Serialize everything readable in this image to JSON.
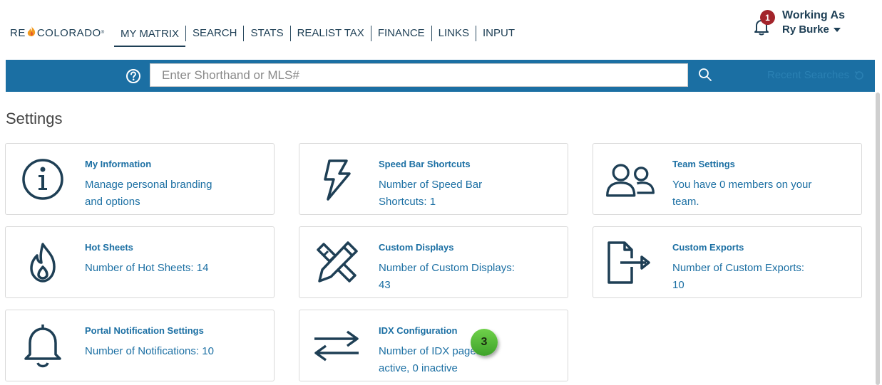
{
  "logo": {
    "text_left": "RE",
    "text_right": "COLORADO",
    "mark": "®"
  },
  "nav": {
    "items": [
      {
        "label": "MY MATRIX"
      },
      {
        "label": "SEARCH"
      },
      {
        "label": "STATS"
      },
      {
        "label": "REALIST TAX"
      },
      {
        "label": "FINANCE"
      },
      {
        "label": "LINKS"
      },
      {
        "label": "INPUT"
      }
    ]
  },
  "notifications": {
    "count": "1",
    "icon": "bell-icon"
  },
  "working_as": {
    "label": "Working As",
    "user": "Ry Burke"
  },
  "search": {
    "placeholder": "Enter Shorthand or MLS#",
    "recent_label": "Recent Searches",
    "help_icon": "question-circle-icon",
    "search_icon": "magnifier-icon"
  },
  "page_title": "Settings",
  "cards": [
    {
      "title": "My Information",
      "desc": "Manage personal branding and options",
      "icon": "info-icon"
    },
    {
      "title": "Speed Bar Shortcuts",
      "desc": "Number of Speed Bar Shortcuts: 1",
      "icon": "lightning-icon"
    },
    {
      "title": "Team Settings",
      "desc": "You have 0 members on your team.",
      "icon": "team-icon"
    },
    {
      "title": "Hot Sheets",
      "desc": "Number of Hot Sheets: 14",
      "icon": "flame-icon"
    },
    {
      "title": "Custom Displays",
      "desc": "Number of Custom Displays: 43",
      "icon": "pencil-ruler-icon"
    },
    {
      "title": "Custom Exports",
      "desc": "Number of Custom Exports: 10",
      "icon": "file-export-icon"
    },
    {
      "title": "Portal Notification Settings",
      "desc": "Number of Notifications: 10",
      "icon": "bell-icon"
    },
    {
      "title": "IDX Configuration",
      "desc": "Number of IDX pages 0 active, 0 inactive",
      "icon": "arrows-exchange-icon"
    }
  ],
  "step_badge": "3",
  "colors": {
    "brand_blue": "#1b6fa3",
    "navy": "#1e3f55",
    "badge_red": "#a3242b",
    "step_green": "#4cb532"
  }
}
